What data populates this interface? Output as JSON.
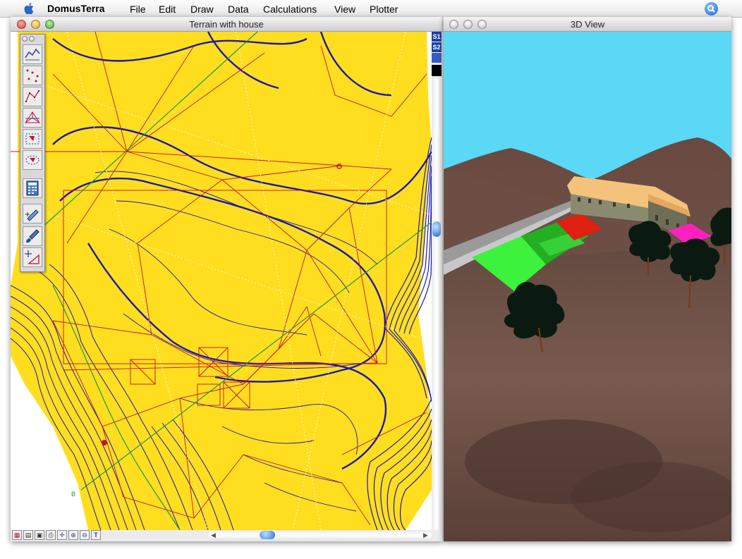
{
  "menubar": {
    "app_name": "DomusTerra",
    "menus": [
      "File",
      "Edit",
      "Draw",
      "Data",
      "Calculations",
      "View",
      "Plotter"
    ]
  },
  "plan_window": {
    "title": "Terrain with house",
    "strip_labels": [
      "S1",
      "S2"
    ],
    "point_label": "B"
  },
  "view_window": {
    "title": "3D View"
  },
  "colors": {
    "terrain_yellow": "#ffde1f",
    "contour_blue": "#1a1aa8",
    "line_red": "#c8102e",
    "line_green": "#1a9a3a",
    "sky": "#5ad8f6",
    "ground": "#6e5348"
  },
  "icons": {
    "palette": [
      "terrain-profile-icon",
      "point-grid-icon",
      "polyline-icon",
      "triangulate-icon",
      "area-select-icon",
      "lasso-select-icon",
      "calculator-icon",
      "pencil-icon",
      "fill-brush-icon",
      "move-triangle-icon"
    ],
    "bottom_bar": [
      "grid-icon",
      "layers-icon",
      "save-icon",
      "print-icon",
      "crosshair-icon",
      "zoom-in-icon",
      "zoom-out-icon",
      "text-icon"
    ]
  }
}
